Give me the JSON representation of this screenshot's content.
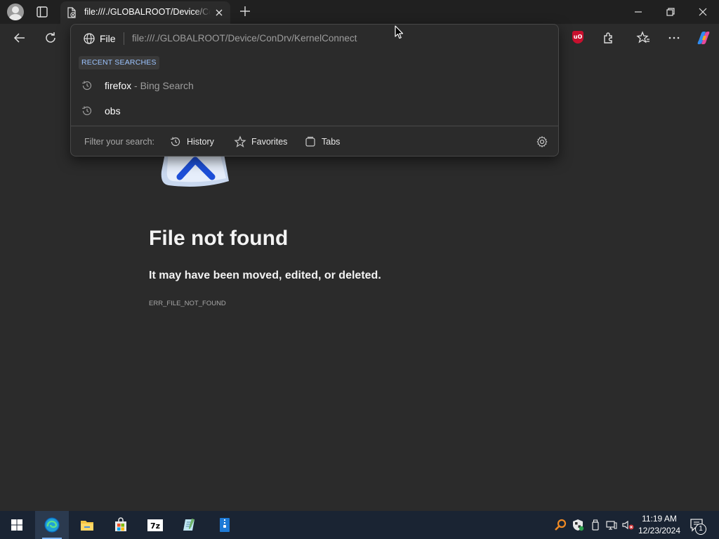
{
  "tab": {
    "title": "file:///./GLOBALROOT/Device/ConDrv/KernelConnect"
  },
  "omnibox": {
    "scheme_label": "File",
    "url": "file:///./GLOBALROOT/Device/ConDrv/KernelConnect",
    "recent_label": "RECENT SEARCHES",
    "suggestions": [
      {
        "text": "firefox",
        "sub": " - Bing Search",
        "icon": "history-icon"
      },
      {
        "text": "obs",
        "sub": "",
        "icon": "history-icon"
      }
    ],
    "filter": {
      "label": "Filter your search:",
      "options": [
        {
          "label": "History",
          "icon": "history-icon"
        },
        {
          "label": "Favorites",
          "icon": "star-icon"
        },
        {
          "label": "Tabs",
          "icon": "tabs-icon"
        }
      ]
    }
  },
  "error": {
    "title": "File not found",
    "subtitle": "It may have been moved, edited, or deleted.",
    "code": "ERR_FILE_NOT_FOUND"
  },
  "taskbar": {
    "apps": [
      "start-icon",
      "edge-icon",
      "file-explorer-icon",
      "store-icon",
      "7zip-icon",
      "notepad-icon",
      "archive-icon"
    ],
    "time": "11:19 AM",
    "date": "12/23/2024",
    "notification_count": "1"
  },
  "colors": {
    "accent": "#0078d4",
    "recent_label_text": "#9cc4ff",
    "page_bg": "#2b2b2b",
    "taskbar_bg": "#1a2433"
  }
}
